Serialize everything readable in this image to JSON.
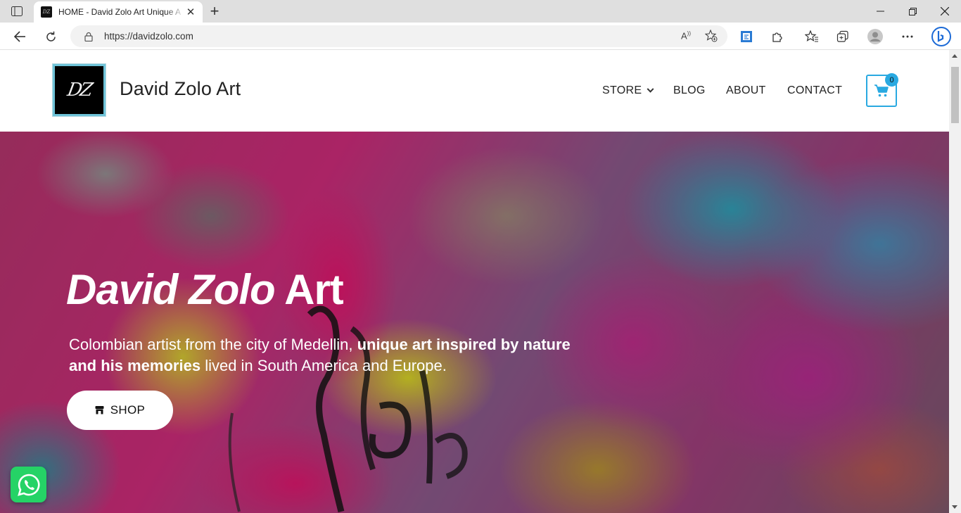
{
  "browser": {
    "tab_title": "HOME - David Zolo Art Unique A",
    "url": "https://davidzolo.com",
    "read_aloud_glyph": "A",
    "icons": [
      "sidebar-icon",
      "close-icon",
      "new-tab-icon",
      "minimize-icon",
      "restore-icon",
      "window-close-icon",
      "back-icon",
      "refresh-icon",
      "lock-icon",
      "read-aloud-icon",
      "add-favorite-icon",
      "translate-icon",
      "extensions-icon",
      "favorites-icon",
      "collections-icon",
      "profile-icon",
      "more-icon",
      "bing-icon"
    ]
  },
  "site": {
    "title": "David Zolo Art",
    "logo_text": "DZ",
    "nav": [
      {
        "label": "STORE",
        "has_dropdown": true
      },
      {
        "label": "BLOG"
      },
      {
        "label": "ABOUT"
      },
      {
        "label": "CONTACT"
      }
    ],
    "cart_count": "0",
    "accent_color": "#29a9e1"
  },
  "hero": {
    "title_italic": "David Zolo",
    "title_rest": " Art",
    "text_1": "Colombian artist from the city of Medellin, ",
    "text_bold": "unique art inspired by nature and his memories",
    "text_2": " lived in South America and Europe.",
    "cta_label": "SHOP"
  },
  "whatsapp": {
    "color": "#25d366"
  }
}
